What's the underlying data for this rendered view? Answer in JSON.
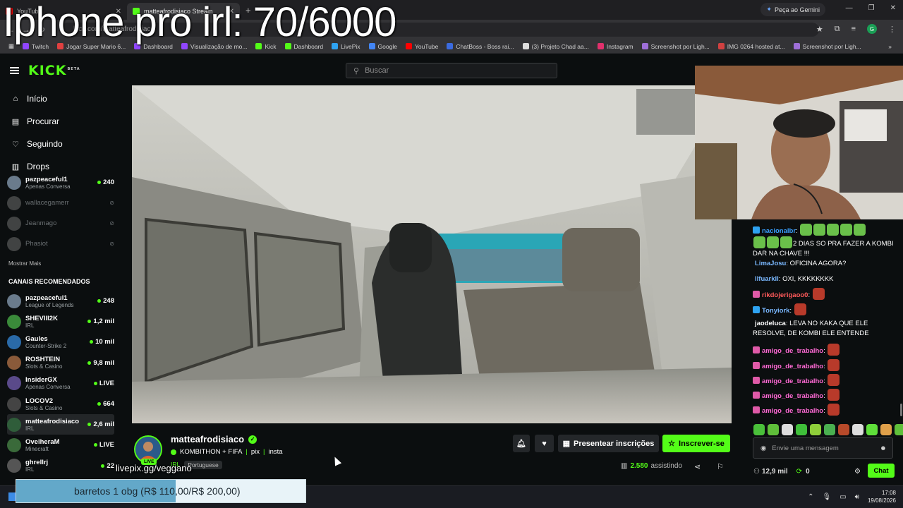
{
  "overlay": {
    "title": "Iphone pro irl: 70/6000",
    "livepix": "livepix.gg/veggano",
    "goal_text": "barretos 1 obg (R$ 110,00/R$ 200,00)",
    "goal_progress": 0.55
  },
  "browser": {
    "tabs": [
      {
        "label": "YouTube",
        "color": "#ff0000"
      },
      {
        "label": "matteafrodisiaco Stream",
        "color": "#53fc18"
      }
    ],
    "gemini_label": "Peça ao Gemini",
    "url": "kick.com/matteafrodisiaco",
    "profile_letter": "G",
    "bookmarks": [
      {
        "label": "Twitch",
        "color": "#9146ff"
      },
      {
        "label": "Jogar Super Mario 6...",
        "color": "#e04040"
      },
      {
        "label": "Dashboard",
        "color": "#9146ff"
      },
      {
        "label": "Visualização de mo...",
        "color": "#9146ff"
      },
      {
        "label": "Kick",
        "color": "#53fc18"
      },
      {
        "label": "Dashboard",
        "color": "#53fc18"
      },
      {
        "label": "LivePix",
        "color": "#2ea3f2"
      },
      {
        "label": "Google",
        "color": "#4285f4"
      },
      {
        "label": "YouTube",
        "color": "#ff0000"
      },
      {
        "label": "ChatBoss - Boss rai...",
        "color": "#3b6be0"
      },
      {
        "label": "(3) Projeto Chad aa...",
        "color": "#dddddd"
      },
      {
        "label": "Instagram",
        "color": "#e1306c"
      },
      {
        "label": "Screenshot por Ligh...",
        "color": "#9e6fd8"
      },
      {
        "label": "IMG 0264 hosted at...",
        "color": "#d04040"
      },
      {
        "label": "Screenshot por Ligh...",
        "color": "#9e6fd8"
      }
    ]
  },
  "header": {
    "logo": "KICK",
    "logo_badge": "BETA",
    "search_placeholder": "Buscar"
  },
  "sidebar": {
    "nav": [
      {
        "label": "Início",
        "icon": "home-icon"
      },
      {
        "label": "Procurar",
        "icon": "browse-icon"
      },
      {
        "label": "Seguindo",
        "icon": "heart-icon"
      },
      {
        "label": "Drops",
        "icon": "drops-icon"
      }
    ],
    "following": [
      {
        "name": "pazpeaceful1",
        "category": "Apenas Conversa",
        "viewers": "240",
        "live": true,
        "color": "#6a7b8c"
      },
      {
        "name": "wallacegamerr",
        "category": "",
        "viewers": "",
        "live": false,
        "color": "#777777"
      },
      {
        "name": "Jeanmago",
        "category": "",
        "viewers": "",
        "live": false,
        "color": "#777777"
      },
      {
        "name": "Phasiot",
        "category": "",
        "viewers": "",
        "live": false,
        "color": "#777777"
      }
    ],
    "show_more": "Mostrar Mais",
    "recommended_title": "CANAIS RECOMENDADOS",
    "recommended": [
      {
        "name": "pazpeaceful1",
        "category": "League of Legends",
        "viewers": "248",
        "color": "#6a7b8c"
      },
      {
        "name": "SHEVIII2K",
        "category": "IRL",
        "viewers": "1,2 mil",
        "color": "#3a8a3a"
      },
      {
        "name": "Gaules",
        "category": "Counter-Strike 2",
        "viewers": "10 mil",
        "color": "#2a6aa8"
      },
      {
        "name": "ROSHTEIN",
        "category": "Slots & Casino",
        "viewers": "9,8 mil",
        "color": "#8a5a3a"
      },
      {
        "name": "InsiderGX",
        "category": "Apenas Conversa",
        "viewers": "LIVE",
        "color": "#5a4a8a"
      },
      {
        "name": "LOCOV2",
        "category": "Slots & Casino",
        "viewers": "664",
        "color": "#444444"
      },
      {
        "name": "matteafrodisiaco",
        "category": "IRL",
        "viewers": "2,6 mil",
        "color": "#2f5d3a"
      },
      {
        "name": "OvelheraM",
        "category": "Minecraft",
        "viewers": "LIVE",
        "color": "#3a6a3a"
      },
      {
        "name": "ghrellrj",
        "category": "IRL",
        "viewers": "22",
        "color": "#555555"
      }
    ]
  },
  "stream": {
    "streamer": "matteafrodisiaco",
    "title_main": "KOMBITHON + FIFA",
    "title_link1": "pix",
    "title_link2": "insta",
    "tag1": "IRL",
    "tag2": "Portuguese",
    "live_label": "LIVE",
    "gift_label": "Presentear inscrições",
    "subscribe_label": "Inscrever-se",
    "viewers": "2.580",
    "viewers_suffix": "assistindo"
  },
  "chat": {
    "messages": [
      {
        "user": "nacionalbr",
        "text": "2 DIAS SO PRA FAZER A KOMBI DAR NA CHAVE !!!",
        "color": "#3aa0ff"
      },
      {
        "user": "LimaJosu",
        "text": "OFICINA AGORA?",
        "color": "#7ab8ff"
      },
      {
        "user": "llfuarkll",
        "text": "OXI, KKKKKKKK",
        "color": "#7ab8ff"
      },
      {
        "user": "rikdojerigaoo0",
        "text": "",
        "color": "#ff5a5a"
      },
      {
        "user": "Tonyiork",
        "text": "",
        "color": "#7ab8ff"
      },
      {
        "user": "jaodeluca",
        "text": "LEVA NO KAKA QUE ELE RESOLVE, DE KOMBI ELE ENTENDE",
        "color": "#ffffff"
      },
      {
        "user": "amigo_de_trabalho",
        "text": "",
        "color": "#ff6ad5"
      },
      {
        "user": "amigo_de_trabalho",
        "text": "",
        "color": "#ff6ad5"
      },
      {
        "user": "amigo_de_trabalho",
        "text": "",
        "color": "#ff6ad5"
      },
      {
        "user": "amigo_de_trabalho",
        "text": "",
        "color": "#ff6ad5"
      },
      {
        "user": "amigo_de_trabalho",
        "text": "",
        "color": "#ff6ad5"
      }
    ],
    "input_placeholder": "Envie uma mensagem",
    "followers": "12,9 mil",
    "kicks": "0",
    "send_label": "Chat"
  },
  "taskbar": {
    "time": "17:08",
    "date": "19/08/2026"
  },
  "colors": {
    "accent": "#53fc18",
    "background": "#0b0e0f"
  }
}
